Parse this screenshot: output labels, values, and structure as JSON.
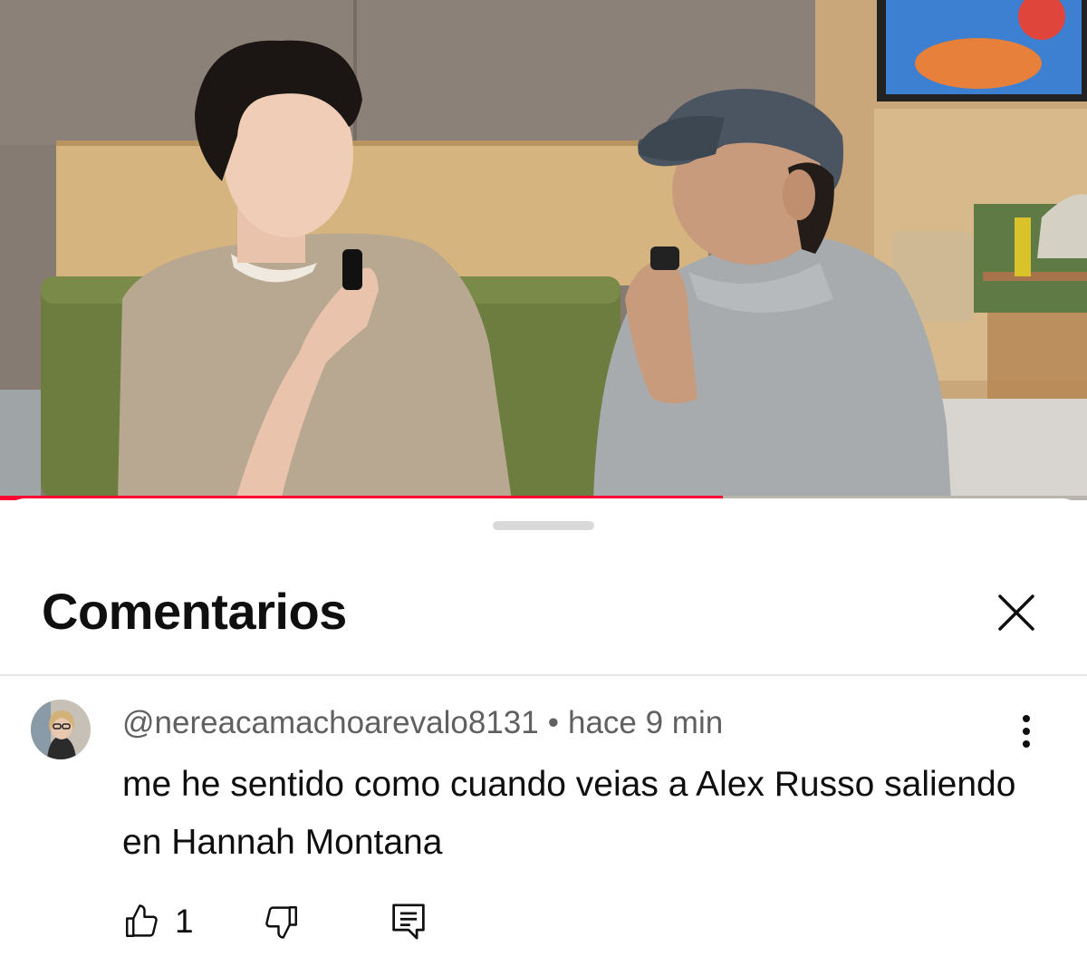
{
  "video": {
    "progress_fraction": 0.665,
    "progress_color": "#ff0033"
  },
  "sheet": {
    "title": "Comentarios",
    "close_icon": "close-icon"
  },
  "comment": {
    "author": "@nereacamachoarevalo8131",
    "separator": "•",
    "time": "hace 9 min",
    "text": "me he sentido como cuando veias a Alex Russo saliendo en Hannah Montana",
    "likes": "1",
    "icons": [
      "thumbs-up-icon",
      "thumbs-down-icon",
      "reply-icon",
      "more-vertical-icon"
    ]
  }
}
